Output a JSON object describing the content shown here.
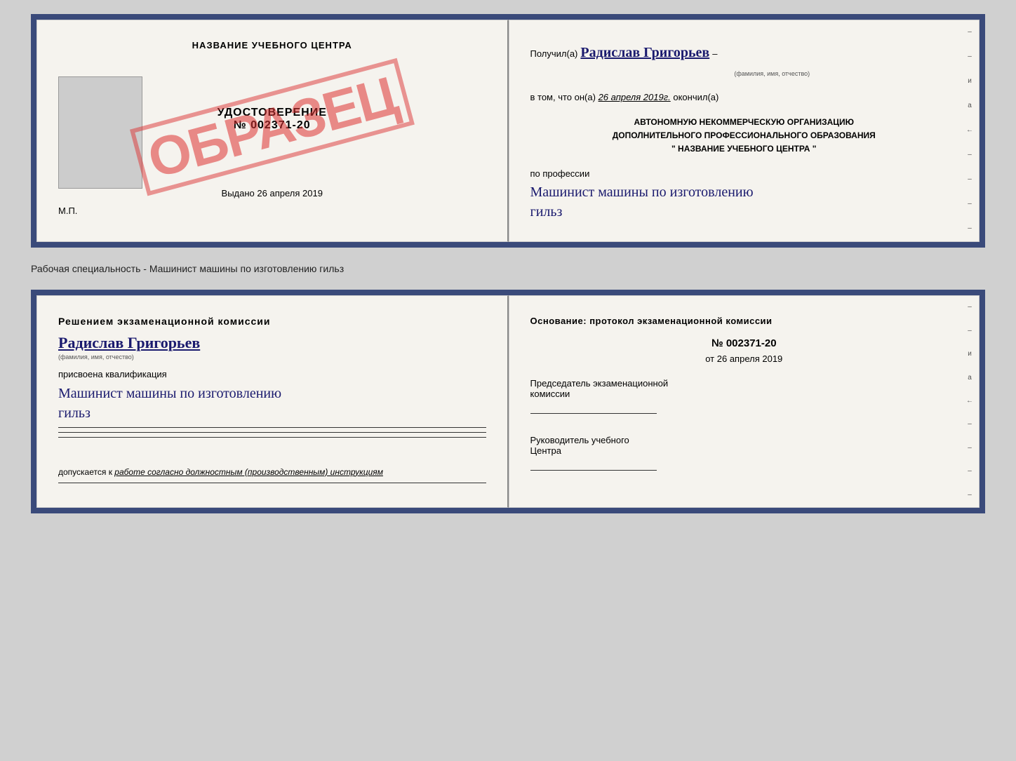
{
  "topDoc": {
    "left": {
      "title": "НАЗВАНИЕ УЧЕБНОГО ЦЕНТРА",
      "stamp": "ОБРАЗЕЦ",
      "udostoverenie": "УДОСТОВЕРЕНИЕ",
      "number": "№ 002371-20",
      "vydano": "Выдано",
      "vydano_date": "26 апреля 2019",
      "mp": "М.П."
    },
    "right": {
      "poluchil": "Получил(а)",
      "name": "Радислав Григорьев",
      "fio_caption": "(фамилия, имя, отчество)",
      "dash": "–",
      "vtom": "в том, что он(а)",
      "date": "26 апреля 2019г.",
      "okonchil": "окончил(а)",
      "org_line1": "АВТОНОМНУЮ НЕКОММЕРЧЕСКУЮ ОРГАНИЗАЦИЮ",
      "org_line2": "ДОПОЛНИТЕЛЬНОГО ПРОФЕССИОНАЛЬНОГО ОБРАЗОВАНИЯ",
      "org_line3": "\"  НАЗВАНИЕ УЧЕБНОГО ЦЕНТРА  \"",
      "po_professii": "по профессии",
      "profession_line1": "Машинист машины по изготовлению",
      "profession_line2": "гильз"
    }
  },
  "caption": "Рабочая специальность - Машинист машины по изготовлению гильз",
  "bottomDoc": {
    "left": {
      "resheniem": "Решением  экзаменационной  комиссии",
      "name": "Радислав Григорьев",
      "fio_caption": "(фамилия, имя, отчество)",
      "prisvoena": "присвоена квалификация",
      "profession_line1": "Машинист машины по изготовлению",
      "profession_line2": "гильз",
      "dopuskaetsya": "допускается к",
      "dopusk_text": "работе согласно должностным (производственным) инструкциям"
    },
    "right": {
      "osnovanie": "Основание: протокол экзаменационной  комиссии",
      "number": "№  002371-20",
      "ot": "от",
      "date": "26 апреля 2019",
      "predsedatel_line1": "Председатель экзаменационной",
      "predsedatel_line2": "комиссии",
      "rukovoditel_line1": "Руководитель учебного",
      "rukovoditel_line2": "Центра"
    }
  },
  "rightEdgeMarks": [
    "и",
    "а",
    "←",
    "–",
    "–",
    "–",
    "–"
  ]
}
